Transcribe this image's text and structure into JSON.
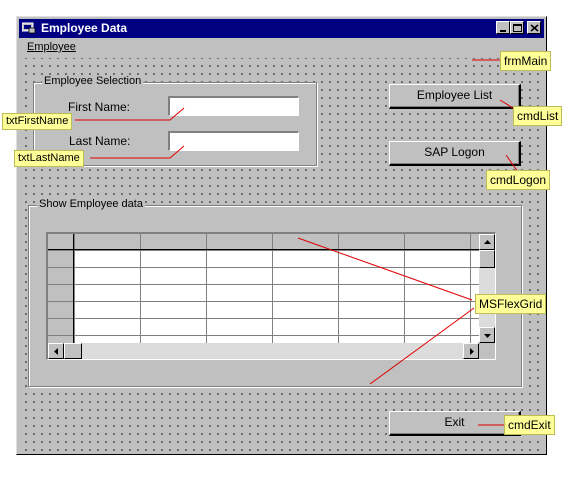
{
  "window": {
    "title": "Employee Data",
    "menu": [
      "Employee"
    ]
  },
  "selection_frame": {
    "label": "Employee Selection",
    "first_name_label": "First Name:",
    "first_name_value": "",
    "last_name_label": "Last Name:",
    "last_name_value": ""
  },
  "buttons": {
    "employee_list": "Employee List",
    "sap_logon": "SAP Logon",
    "exit": "Exit"
  },
  "data_frame": {
    "label": "Show Employee data"
  },
  "annotations": {
    "frm_main": "frmMain",
    "txt_first_name": "txtFirstName",
    "txt_last_name": "txtLastName",
    "cmd_list": "cmdList",
    "cmd_logon": "cmdLogon",
    "ms_flex_grid": "MSFlexGrid",
    "cmd_exit": "cmdExit"
  },
  "colors": {
    "title_bar": "#000080",
    "form_face": "#c0c0c0",
    "annotation_fill": "#ffff99",
    "annotation_line": "#ff0000"
  },
  "icons": [
    "app-icon",
    "minimize-icon",
    "maximize-icon",
    "close-icon",
    "scroll-up-icon",
    "scroll-down-icon",
    "scroll-left-icon",
    "scroll-right-icon"
  ]
}
